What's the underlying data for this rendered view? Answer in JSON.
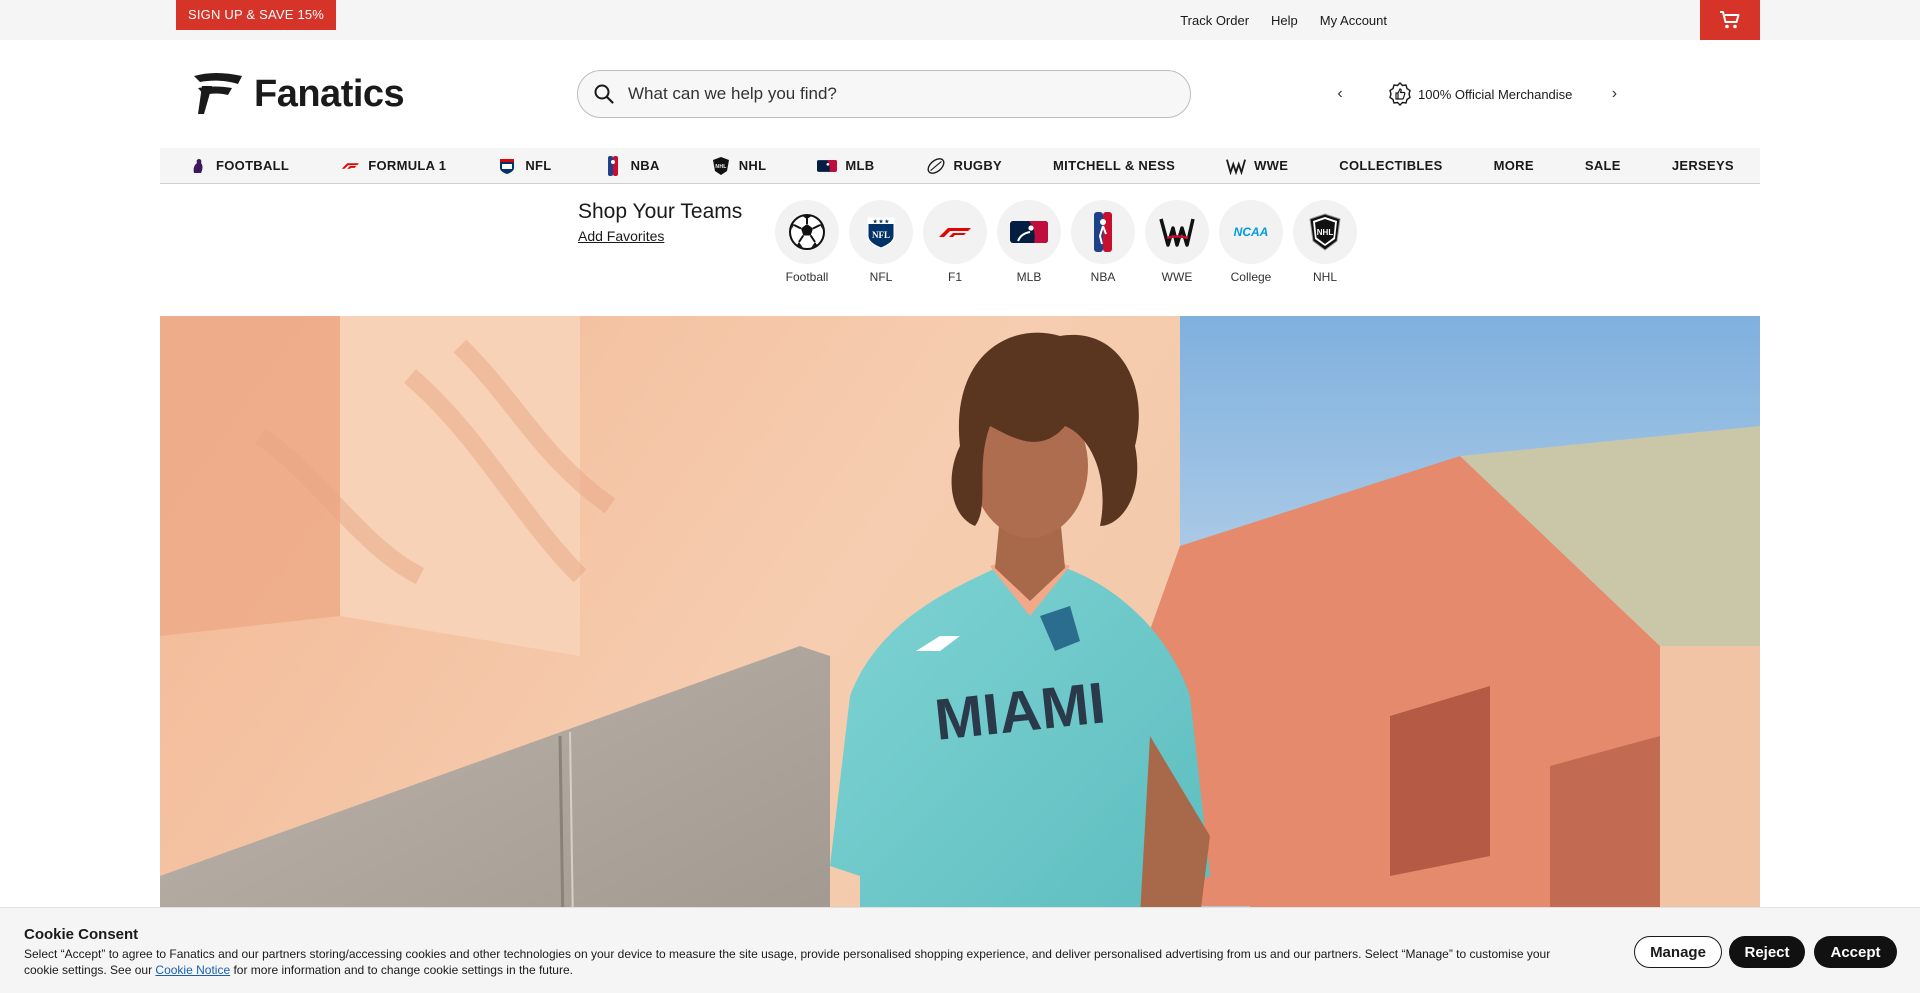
{
  "topbar": {
    "signup_label": "SIGN UP & SAVE 15%",
    "links": [
      "Track Order",
      "Help",
      "My Account"
    ],
    "cart_icon": "cart-icon"
  },
  "header": {
    "logo_text": "Fanatics",
    "search_placeholder": "What can we help you find?",
    "promo_message": "100% Official Merchandise"
  },
  "nav": {
    "items": [
      {
        "label": "FOOTBALL",
        "icon": "premier-league-icon"
      },
      {
        "label": "FORMULA 1",
        "icon": "f1-icon"
      },
      {
        "label": "NFL",
        "icon": "nfl-icon"
      },
      {
        "label": "NBA",
        "icon": "nba-icon"
      },
      {
        "label": "NHL",
        "icon": "nhl-icon"
      },
      {
        "label": "MLB",
        "icon": "mlb-icon"
      },
      {
        "label": "RUGBY",
        "icon": "rugby-icon"
      },
      {
        "label": "MITCHELL & NESS",
        "icon": ""
      },
      {
        "label": "WWE",
        "icon": "wwe-icon"
      },
      {
        "label": "COLLECTIBLES",
        "icon": ""
      },
      {
        "label": "MORE",
        "icon": ""
      },
      {
        "label": "SALE",
        "icon": ""
      },
      {
        "label": "JERSEYS",
        "icon": ""
      }
    ]
  },
  "teams": {
    "title": "Shop Your Teams",
    "add_favorites": "Add Favorites",
    "items": [
      "Football",
      "NFL",
      "F1",
      "MLB",
      "NBA",
      "WWE",
      "College",
      "NHL"
    ]
  },
  "cookie": {
    "title": "Cookie Consent",
    "text_before": "Select “Accept” to agree to Fanatics and our partners storing/accessing cookies and other technologies on your device to measure the site usage, provide personalised shopping experience, and deliver personalised advertising from us and our partners. Select “Manage” to customise your cookie settings. See our ",
    "link_label": "Cookie Notice",
    "text_after": " for more information and to change cookie settings in the future.",
    "manage_label": "Manage",
    "reject_label": "Reject",
    "accept_label": "Accept"
  },
  "colors": {
    "brand_red": "#d63329",
    "dark": "#111111"
  }
}
